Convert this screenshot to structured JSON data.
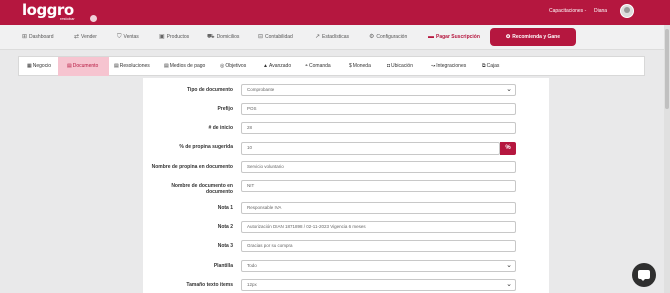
{
  "brand": {
    "name": "loggro",
    "tagline": "restobar"
  },
  "topbar": {
    "company": "Capacitaciones -",
    "user": "Diana"
  },
  "nav": {
    "items": [
      {
        "label": "Dashboard",
        "icon": "⊞"
      },
      {
        "label": "Vender",
        "icon": "⇄"
      },
      {
        "label": "Ventas",
        "icon": "⛉"
      },
      {
        "label": "Productos",
        "icon": "▣"
      },
      {
        "label": "Domicilios",
        "icon": "⛟"
      },
      {
        "label": "Contabilidad",
        "icon": "⊟"
      },
      {
        "label": "Estadísticas",
        "icon": "↗"
      },
      {
        "label": "Configuración",
        "icon": "⚙"
      }
    ],
    "pay": {
      "label": "Pagar Suscripción",
      "icon": "▬"
    },
    "recommend": {
      "label": "Recomienda y Gane",
      "icon": "✪"
    }
  },
  "tabs": [
    {
      "label": "Negocio",
      "icon": "▦"
    },
    {
      "label": "Documento",
      "icon": "▤"
    },
    {
      "label": "Resoluciones",
      "icon": "▤"
    },
    {
      "label": "Medios de pago",
      "icon": "▤"
    },
    {
      "label": "Objetivos",
      "icon": "◎"
    },
    {
      "label": "Avanzado",
      "icon": "▲"
    },
    {
      "label": "Comanda",
      "icon": "◓"
    },
    {
      "label": "Moneda",
      "icon": "$"
    },
    {
      "label": "Ubicación",
      "icon": "◘"
    },
    {
      "label": "Integraciones",
      "icon": "↝"
    },
    {
      "label": "Cajas",
      "icon": "⧉"
    }
  ],
  "active_tab": "Documento",
  "form": {
    "tipo_documento": {
      "label": "Tipo de documento",
      "value": "Comprobante"
    },
    "prefijo": {
      "label": "Prefijo",
      "value": "POS"
    },
    "inicio": {
      "label": "# de inicio",
      "value": "28"
    },
    "propina": {
      "label": "% de propina sugerida",
      "value": "10",
      "suffix": "%"
    },
    "nombre_propina": {
      "label": "Nombre de propina en documento",
      "value": "Servicio voluntario"
    },
    "nombre_documento": {
      "label_line1": "Nombre de documento en",
      "label_line2": "documento",
      "value": "NIT"
    },
    "nota1": {
      "label": "Nota 1",
      "value": "Responsable IVA"
    },
    "nota2": {
      "label": "Nota 2",
      "value": "Autorización DIAN 1871898 / 02-11-2023 Vigencia 6 meses"
    },
    "nota3": {
      "label": "Nota 3",
      "value": "Gracias por su compra"
    },
    "plantilla": {
      "label": "Plantilla",
      "value": "Todo"
    },
    "tamano": {
      "label": "Tamaño texto items",
      "value": "12px"
    }
  }
}
